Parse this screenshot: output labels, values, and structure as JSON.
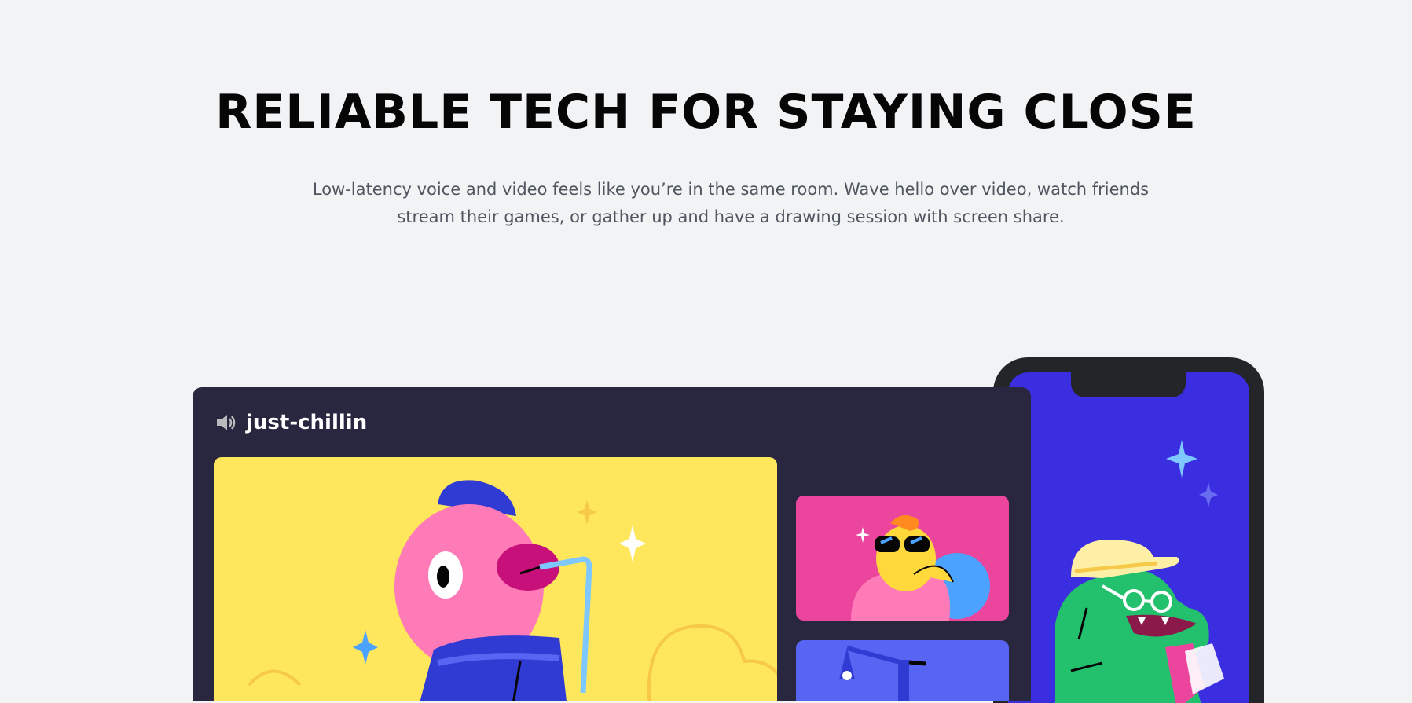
{
  "hero": {
    "title": "RELIABLE TECH FOR STAYING CLOSE",
    "subtitle": "Low-latency voice and video feels like you’re in the same room. Wave hello over video, watch friends stream their games, or gather up and have a drawing session with screen share."
  },
  "voice_channel": {
    "name": "just-chillin",
    "icon": "speaker-icon"
  },
  "colors": {
    "background": "#f2f3f5",
    "window": "#28273f",
    "tile_main": "#fee75c",
    "tile_pink": "#eb459e",
    "tile_blurple": "#5865f2",
    "phone_screen": "#3b2ee0",
    "phone_frame": "#232528"
  }
}
